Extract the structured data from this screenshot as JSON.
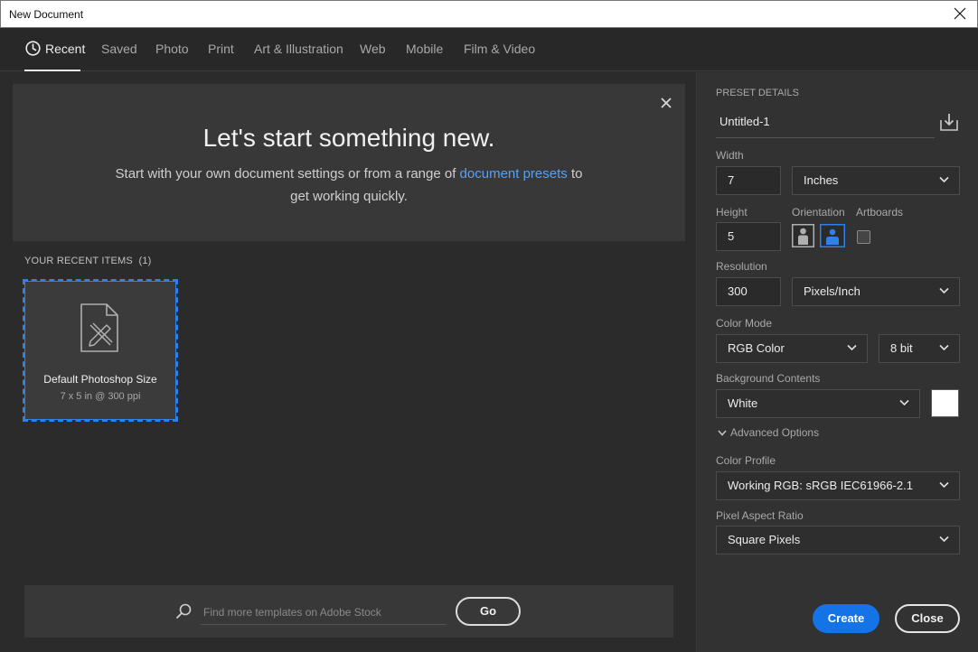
{
  "window": {
    "title": "New Document"
  },
  "tabs": [
    {
      "label": "Recent",
      "active": true
    },
    {
      "label": "Saved"
    },
    {
      "label": "Photo"
    },
    {
      "label": "Print"
    },
    {
      "label": "Art & Illustration"
    },
    {
      "label": "Web"
    },
    {
      "label": "Mobile"
    },
    {
      "label": "Film & Video"
    }
  ],
  "hero": {
    "heading": "Let's start something new.",
    "text_before": "Start with your own document settings or from a range of ",
    "link": "document presets",
    "text_after": " to",
    "text_line2": "get working quickly."
  },
  "recent": {
    "label": "YOUR RECENT ITEMS",
    "count": "(1)",
    "items": [
      {
        "name": "Default Photoshop Size",
        "meta": "7 x 5 in @ 300 ppi"
      }
    ]
  },
  "stock": {
    "placeholder": "Find more templates on Adobe Stock",
    "go_label": "Go"
  },
  "preset": {
    "section_label": "PRESET DETAILS",
    "name": "Untitled-1",
    "width_label": "Width",
    "width_value": "7",
    "width_unit": "Inches",
    "height_label": "Height",
    "height_value": "5",
    "orientation_label": "Orientation",
    "artboards_label": "Artboards",
    "resolution_label": "Resolution",
    "resolution_value": "300",
    "resolution_unit": "Pixels/Inch",
    "color_mode_label": "Color Mode",
    "color_mode": "RGB Color",
    "bit_depth": "8 bit",
    "background_label": "Background Contents",
    "background": "White",
    "background_color": "#ffffff",
    "advanced_label": "Advanced Options",
    "color_profile_label": "Color Profile",
    "color_profile": "Working RGB: sRGB IEC61966-2.1",
    "pixel_ratio_label": "Pixel Aspect Ratio",
    "pixel_ratio": "Square Pixels"
  },
  "actions": {
    "create": "Create",
    "close": "Close"
  },
  "colors": {
    "accent": "#1473e6",
    "link": "#5aa0f2",
    "selection": "#2e80ea"
  }
}
